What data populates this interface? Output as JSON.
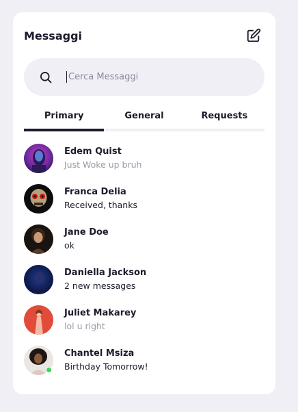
{
  "header": {
    "title": "Messaggi",
    "compose_icon": "edit-square-icon"
  },
  "search": {
    "placeholder": "Cerca Messaggi",
    "icon": "search-icon"
  },
  "tabs": [
    {
      "label": "Primary",
      "active": true
    },
    {
      "label": "General",
      "active": false
    },
    {
      "label": "Requests",
      "active": false
    }
  ],
  "conversations": [
    {
      "name": "Edem Quist",
      "message": "Just Woke up bruh",
      "read": true,
      "online": false
    },
    {
      "name": "Franca Delia",
      "message": "Received, thanks",
      "read": false,
      "online": false
    },
    {
      "name": "Jane Doe",
      "message": "ok",
      "read": false,
      "online": false
    },
    {
      "name": "Daniella Jackson",
      "message": "2 new messages",
      "read": false,
      "online": false
    },
    {
      "name": "Juliet Makarey",
      "message": "lol u right",
      "read": true,
      "online": false
    },
    {
      "name": "Chantel Msiza",
      "message": "Birthday Tomorrow!",
      "read": false,
      "online": true
    }
  ],
  "colors": {
    "background": "#f0eff6",
    "card": "#ffffff",
    "text": "#1d1b2b",
    "muted": "#9b99a8",
    "online": "#3ed65a"
  }
}
